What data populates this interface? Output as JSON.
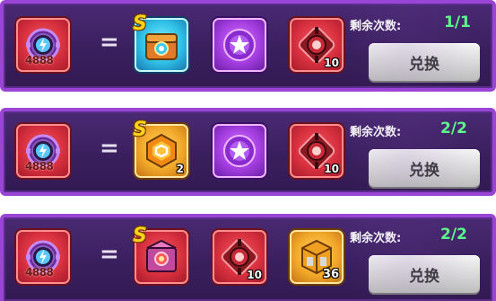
{
  "equals_sign": "=",
  "s_badge": "S",
  "remaining_label": "剩余次数:",
  "button_label": "兑换",
  "colors": {
    "remaining_value": "#5dff8a",
    "button_text": "#3a3a3a",
    "row_border": "#9a45d6"
  },
  "offers": [
    {
      "cost_item": {
        "icon": "purple-energy-ring-icon",
        "amount": "4888"
      },
      "rewards": [
        {
          "icon": "orange-treasure-chest-icon",
          "frame": "cyan",
          "badge": "S",
          "count": ""
        },
        {
          "icon": "purple-star-orb-icon",
          "frame": "purple",
          "count": ""
        },
        {
          "icon": "red-core-chip-icon",
          "frame": "red",
          "count": "10"
        }
      ],
      "remaining": "1/1",
      "button": "兑换"
    },
    {
      "cost_item": {
        "icon": "purple-energy-ring-icon",
        "amount": "4888"
      },
      "rewards": [
        {
          "icon": "gold-hexagon-emblem-icon",
          "frame": "gold",
          "badge": "S",
          "count": "2"
        },
        {
          "icon": "purple-star-orb-icon",
          "frame": "purple",
          "count": ""
        },
        {
          "icon": "red-core-chip-icon",
          "frame": "red",
          "count": "10"
        }
      ],
      "remaining": "2/2",
      "button": "兑换"
    },
    {
      "cost_item": {
        "icon": "purple-energy-ring-icon",
        "amount": "4888"
      },
      "rewards": [
        {
          "icon": "pink-mech-chest-icon",
          "frame": "red",
          "badge": "S",
          "count": ""
        },
        {
          "icon": "red-core-chip-icon",
          "frame": "red",
          "count": "10"
        },
        {
          "icon": "gold-cube-block-icon",
          "frame": "gold",
          "count": "36"
        }
      ],
      "remaining": "2/2",
      "button": "兑换"
    }
  ]
}
